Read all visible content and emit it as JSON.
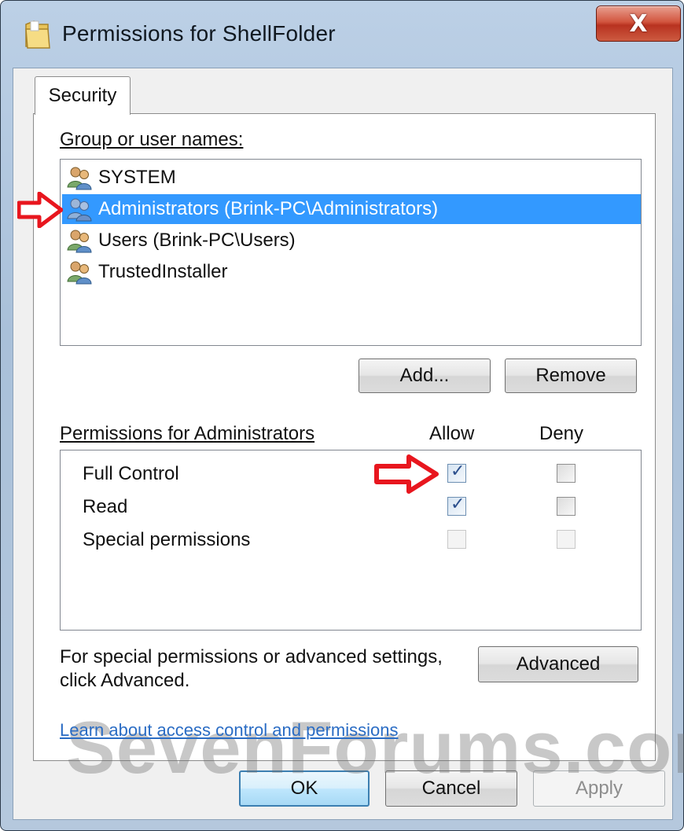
{
  "window": {
    "title": "Permissions for ShellFolder",
    "close_label": "X",
    "icon": "folder-icon"
  },
  "tabs": [
    {
      "label": "Security",
      "selected": true
    }
  ],
  "group_section": {
    "label": "Group or user names:",
    "items": [
      {
        "name": "SYSTEM",
        "icon": "users-icon",
        "selected": false
      },
      {
        "name": "Administrators (Brink-PC\\Administrators)",
        "icon": "users-icon",
        "selected": true
      },
      {
        "name": "Users (Brink-PC\\Users)",
        "icon": "users-icon",
        "selected": false
      },
      {
        "name": "TrustedInstaller",
        "icon": "users-icon",
        "selected": false
      }
    ],
    "add_button": "Add...",
    "remove_button": "Remove"
  },
  "permissions": {
    "label": "Permissions for Administrators",
    "allow_header": "Allow",
    "deny_header": "Deny",
    "rows": [
      {
        "name": "Full Control",
        "allow": true,
        "deny": false,
        "enabled": true
      },
      {
        "name": "Read",
        "allow": true,
        "deny": false,
        "enabled": true
      },
      {
        "name": "Special permissions",
        "allow": false,
        "deny": false,
        "enabled": false
      }
    ]
  },
  "advanced": {
    "text_line1": "For special permissions or advanced settings,",
    "text_line2": "click Advanced.",
    "button": "Advanced"
  },
  "learn_link": "Learn about access control and permissions",
  "watermark": "SevenForums.com",
  "footer": {
    "ok": "OK",
    "cancel": "Cancel",
    "apply": "Apply"
  },
  "colors": {
    "selection": "#3399ff",
    "annotation_arrow": "#e8161e",
    "link": "#2a6cc4"
  }
}
